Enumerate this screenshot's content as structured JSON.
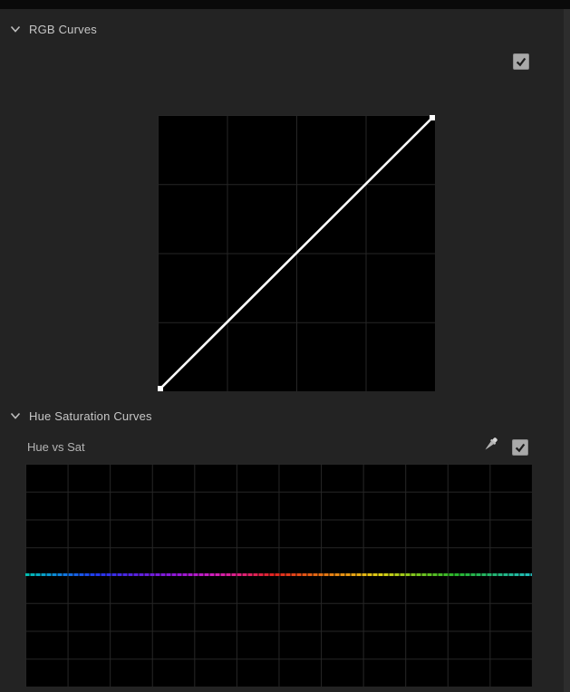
{
  "colors": {
    "panel_bg": "#232323",
    "top_edge": "#0a0a0a",
    "grid_bg": "#000000",
    "grid_line": "#262626",
    "header_text": "#c6c6c6",
    "label_text": "#b4b4b4",
    "checkbox_bg": "#a9a9a9",
    "checkbox_check": "#1e1e1e",
    "selection_ring": "#4e92d8",
    "curve_line": "#ffffff",
    "scrollbar_track": "#2d2d2d"
  },
  "rgb_curves": {
    "title": "RGB Curves",
    "expanded": true,
    "bypass_checked": true,
    "channels": [
      {
        "id": "master",
        "color": "#ffffff",
        "selected": true
      },
      {
        "id": "red",
        "color": "#8e0a0a",
        "selected": false
      },
      {
        "id": "green",
        "color": "#1f8a1f",
        "selected": false
      },
      {
        "id": "blue",
        "color": "#2222cf",
        "selected": false
      }
    ],
    "curve": {
      "type": "line",
      "channel": "master",
      "points_normalized": [
        [
          0,
          0
        ],
        [
          1,
          1
        ]
      ],
      "description": "identity diagonal, no adjustment",
      "grid": {
        "cols": 4,
        "rows": 4
      },
      "line_color": "#ffffff"
    }
  },
  "hue_sat_curves": {
    "title": "Hue Saturation Curves",
    "expanded": true,
    "curve_label": "Hue vs Sat",
    "bypass_checked": true,
    "curve": {
      "type": "line",
      "description": "flat dashed spectrum line at vertical center (neutral saturation)",
      "grid": {
        "cols": 12,
        "rows": 8
      },
      "spectrum_stops": [
        {
          "pos": 0,
          "color": "#00c0ae"
        },
        {
          "pos": 7,
          "color": "#0f7fdd"
        },
        {
          "pos": 14,
          "color": "#2238ee"
        },
        {
          "pos": 22,
          "color": "#5a22dd"
        },
        {
          "pos": 30,
          "color": "#9418d8"
        },
        {
          "pos": 37,
          "color": "#d01fbc"
        },
        {
          "pos": 43,
          "color": "#e02277"
        },
        {
          "pos": 49,
          "color": "#e02420"
        },
        {
          "pos": 57,
          "color": "#e26414"
        },
        {
          "pos": 64,
          "color": "#e69c14"
        },
        {
          "pos": 70,
          "color": "#ddcf16"
        },
        {
          "pos": 77,
          "color": "#7cc41e"
        },
        {
          "pos": 85,
          "color": "#28b32c"
        },
        {
          "pos": 93,
          "color": "#23b377"
        },
        {
          "pos": 100,
          "color": "#20bdbd"
        }
      ]
    }
  }
}
